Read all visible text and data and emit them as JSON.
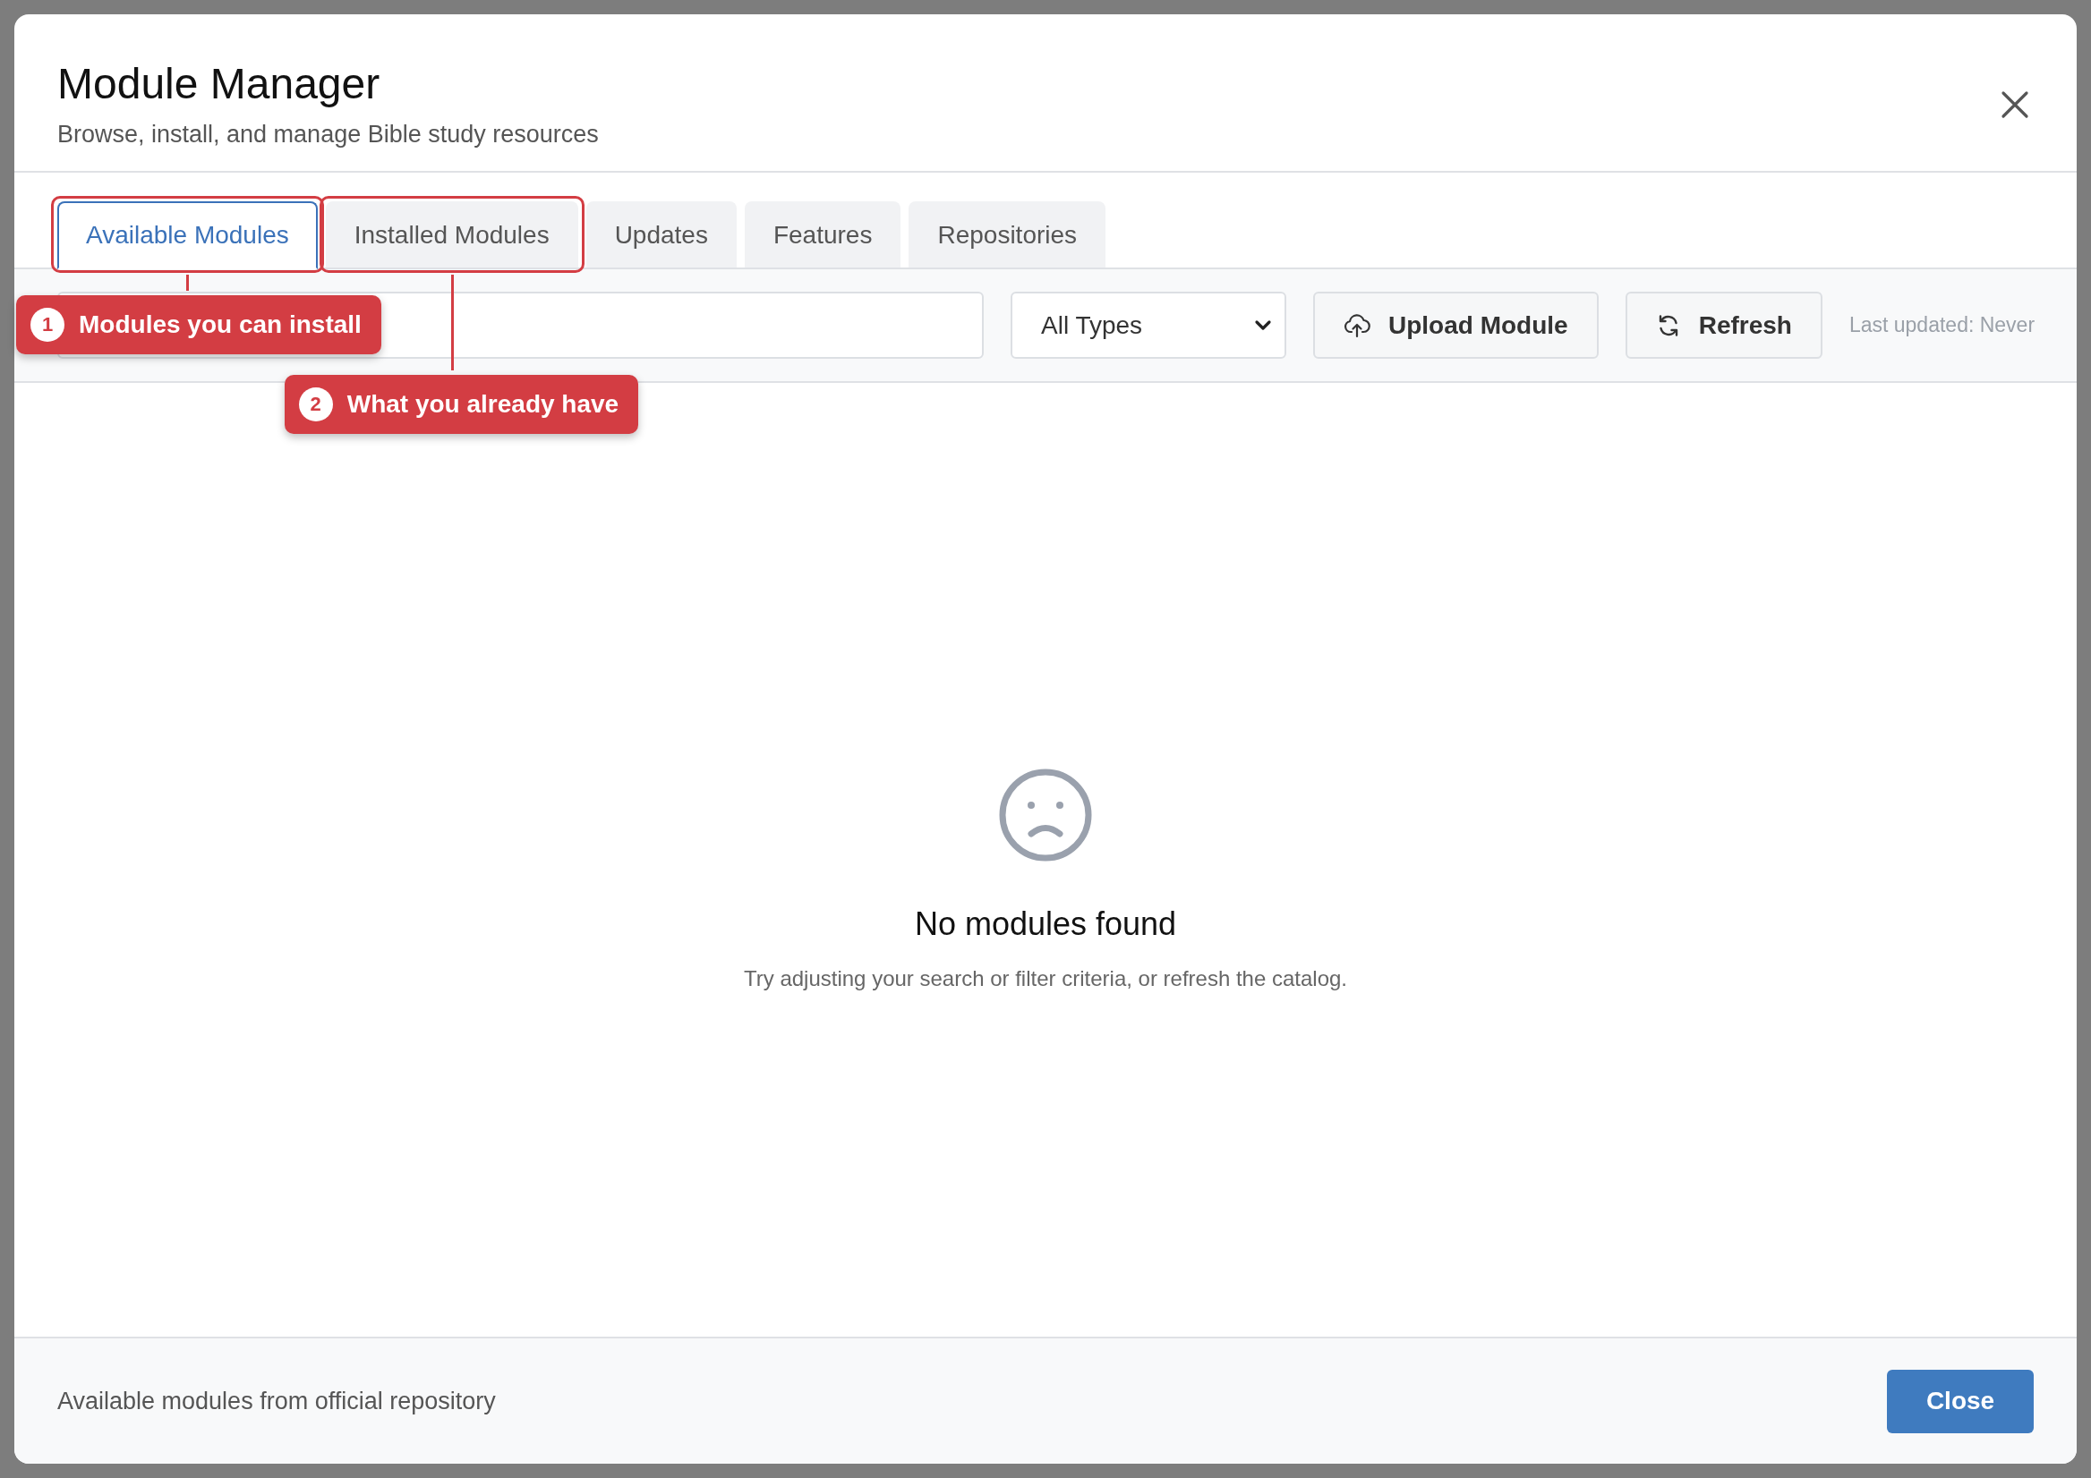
{
  "dialog": {
    "title": "Module Manager",
    "subtitle": "Browse, install, and manage Bible study resources"
  },
  "tabs": [
    {
      "label": "Available Modules",
      "selected": true,
      "callout": {
        "number": "1",
        "text": "Modules you can install"
      }
    },
    {
      "label": "Installed Modules",
      "selected": false,
      "callout": {
        "number": "2",
        "text": "What you already have"
      }
    },
    {
      "label": "Updates",
      "selected": false
    },
    {
      "label": "Features",
      "selected": false
    },
    {
      "label": "Repositories",
      "selected": false
    }
  ],
  "toolbar": {
    "type_filter": "All Types",
    "upload_button": "Upload Module",
    "refresh_button": "Refresh",
    "last_updated": "Last updated: Never"
  },
  "empty_state": {
    "title": "No modules found",
    "message": "Try adjusting your search or filter criteria, or refresh the catalog."
  },
  "footer": {
    "status": "Available modules from official repository",
    "close_button": "Close"
  }
}
